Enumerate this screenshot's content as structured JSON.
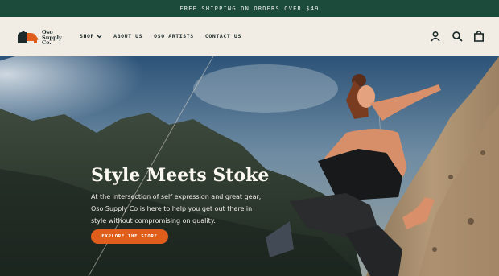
{
  "announcement": "FREE SHIPPING ON ORDERS OVER $49",
  "brand": {
    "logo_lines": [
      "Oso",
      "Supply",
      "Co."
    ]
  },
  "nav": {
    "items": [
      "SHOP",
      "ABOUT US",
      "OSO ARTISTS",
      "CONTACT US"
    ]
  },
  "hero": {
    "title": "Style Meets Stoke",
    "subtitle": "At the intersection of self expression and great gear, Oso Supply Co is here to help you get out there in style without compromising on quality.",
    "cta": "EXPLORE THE STORE"
  },
  "colors": {
    "announce_bg": "#1c4b3c",
    "accent": "#df5e1b",
    "header_bg": "#f1ede4"
  },
  "icons": [
    "account-icon",
    "search-icon",
    "cart-icon",
    "chevron-down-icon"
  ]
}
